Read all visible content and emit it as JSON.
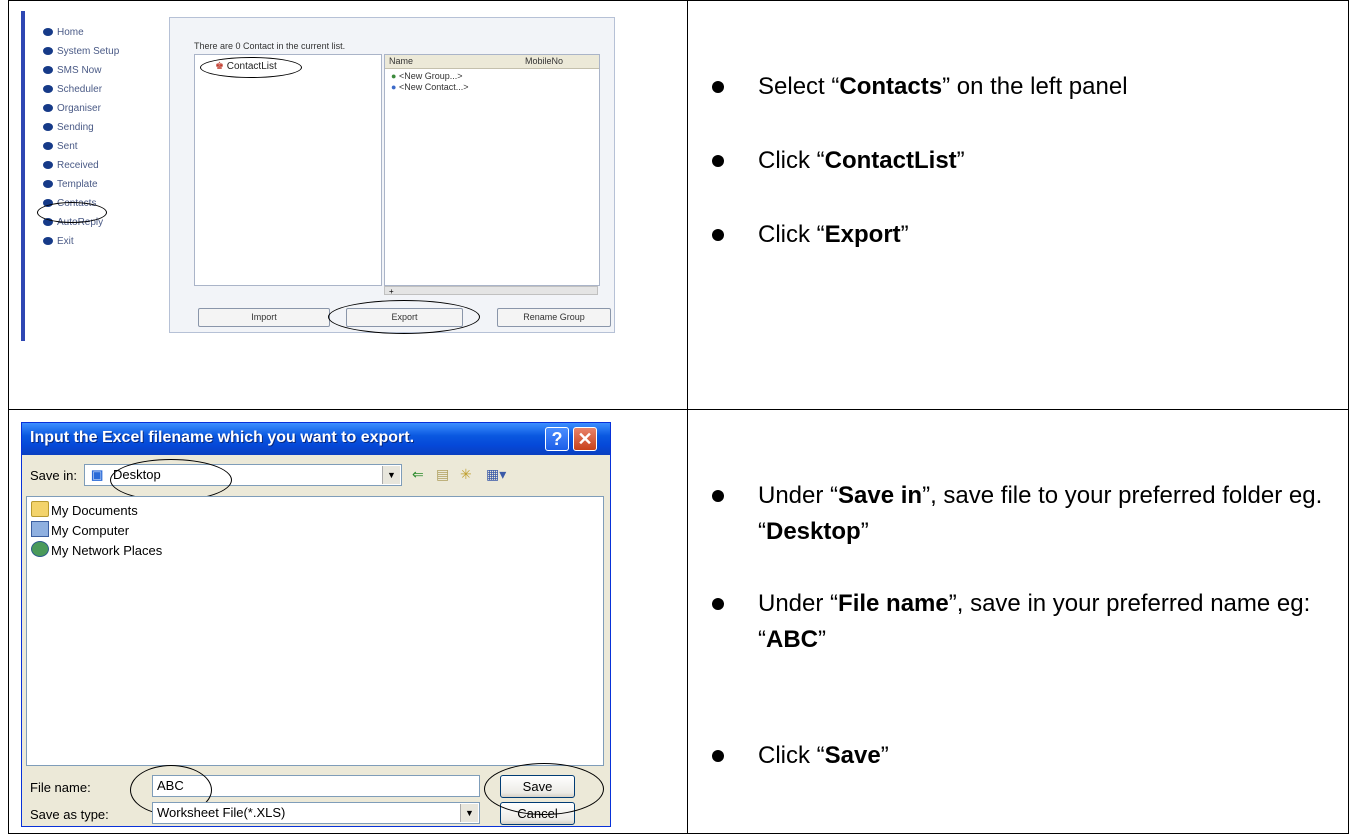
{
  "top_screenshot": {
    "menu": [
      "Home",
      "System Setup",
      "SMS Now",
      "Scheduler",
      "Organiser",
      "Sending",
      "Sent",
      "Received",
      "Template",
      "Contacts",
      "AutoReply",
      "Exit"
    ],
    "message": "There are 0 Contact in the current list.",
    "tree_node": "ContactList",
    "columns": [
      "Name",
      "MobileNo"
    ],
    "rows": [
      "<New Group...>",
      "<New Contact...>"
    ],
    "buttons": {
      "import": "Import",
      "export": "Export",
      "rename": "Rename Group"
    }
  },
  "top_instructions": [
    {
      "pre": "Select “",
      "bold": "Contacts",
      "post": "” on the left panel"
    },
    {
      "pre": "Click “",
      "bold": "ContactList",
      "post": "”"
    },
    {
      "pre": "Click “",
      "bold": "Export",
      "post": "”"
    }
  ],
  "dialog": {
    "title": "Input the Excel filename which you want to export.",
    "save_in_label": "Save in:",
    "save_in_value": "Desktop",
    "items": [
      "My Documents",
      "My Computer",
      "My Network Places"
    ],
    "file_name_label": "File name:",
    "file_name_value": "ABC",
    "save_type_label": "Save as type:",
    "save_type_value": "Worksheet File(*.XLS)",
    "save_button": "Save",
    "cancel_button": "Cancel",
    "help_glyph": "?",
    "close_glyph": "✕"
  },
  "bottom_instructions": [
    {
      "pre": "Under “",
      "bold": "Save in",
      "post": "”, save file to your preferred folder eg. “",
      "bold2": "Desktop",
      "post2": "”"
    },
    {
      "pre": "Under “",
      "bold": "File name",
      "post": "”, save in your preferred name eg: “",
      "bold2": "ABC",
      "post2": "”"
    },
    {
      "pre": "Click “",
      "bold": "Save",
      "post": "”"
    }
  ],
  "colors": {
    "titlebar": "#0548d8",
    "menu_dot": "#163a88",
    "accent_bar": "#2e47b3"
  }
}
